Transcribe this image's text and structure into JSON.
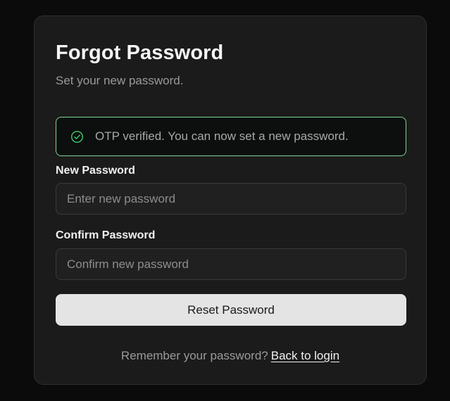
{
  "header": {
    "title": "Forgot Password",
    "subtitle": "Set your new password."
  },
  "alert": {
    "icon": "check-circle-icon",
    "message": "OTP verified. You can now set a new password.",
    "color": "#7fd39a"
  },
  "form": {
    "new_password": {
      "label": "New Password",
      "placeholder": "Enter new password",
      "value": ""
    },
    "confirm_password": {
      "label": "Confirm Password",
      "placeholder": "Confirm new password",
      "value": ""
    },
    "submit_label": "Reset Password"
  },
  "footer": {
    "prompt": "Remember your password?",
    "link_label": "Back to login"
  },
  "colors": {
    "background": "#0b0b0b",
    "card": "#1b1b1b",
    "button": "#e4e4e4"
  }
}
